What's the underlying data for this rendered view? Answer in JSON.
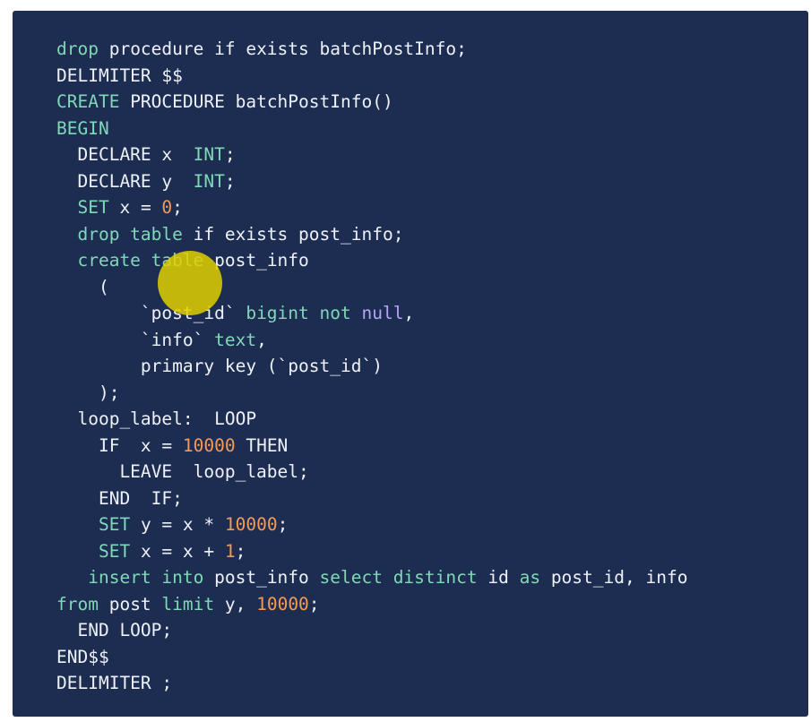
{
  "colors": {
    "background": "#1d2d52",
    "text": "#eef1f7",
    "keyword": "#7fd8b6",
    "number": "#f59a55",
    "literal": "#b8a4f5",
    "cursor": "#e2d000"
  },
  "code": {
    "lines": [
      [
        {
          "t": "drop",
          "c": "kw"
        },
        {
          "t": " procedure if exists batchPostInfo;",
          "c": "plain"
        }
      ],
      [
        {
          "t": "DELIMITER $$",
          "c": "plain"
        }
      ],
      [
        {
          "t": "CREATE",
          "c": "kw"
        },
        {
          "t": " PROCEDURE batchPostInfo()",
          "c": "plain"
        }
      ],
      [
        {
          "t": "BEGIN",
          "c": "kw"
        }
      ],
      [
        {
          "t": "  DECLARE x  ",
          "c": "plain"
        },
        {
          "t": "INT",
          "c": "kw"
        },
        {
          "t": ";",
          "c": "plain"
        }
      ],
      [
        {
          "t": "  DECLARE y  ",
          "c": "plain"
        },
        {
          "t": "INT",
          "c": "kw"
        },
        {
          "t": ";",
          "c": "plain"
        }
      ],
      [
        {
          "t": "  ",
          "c": "plain"
        },
        {
          "t": "SET",
          "c": "kw"
        },
        {
          "t": " x = ",
          "c": "plain"
        },
        {
          "t": "0",
          "c": "num"
        },
        {
          "t": ";",
          "c": "plain"
        }
      ],
      [
        {
          "t": "  ",
          "c": "plain"
        },
        {
          "t": "drop table",
          "c": "kw"
        },
        {
          "t": " if exists post_info;",
          "c": "plain"
        }
      ],
      [
        {
          "t": "  ",
          "c": "plain"
        },
        {
          "t": "create table",
          "c": "kw"
        },
        {
          "t": " post_info",
          "c": "plain"
        }
      ],
      [
        {
          "t": "    (",
          "c": "plain"
        }
      ],
      [
        {
          "t": "        `post_id` ",
          "c": "plain"
        },
        {
          "t": "bigint",
          "c": "kw"
        },
        {
          "t": " ",
          "c": "plain"
        },
        {
          "t": "not",
          "c": "kw"
        },
        {
          "t": " ",
          "c": "plain"
        },
        {
          "t": "null",
          "c": "lit"
        },
        {
          "t": ",",
          "c": "plain"
        }
      ],
      [
        {
          "t": "        `info` ",
          "c": "plain"
        },
        {
          "t": "text",
          "c": "kw"
        },
        {
          "t": ",",
          "c": "plain"
        }
      ],
      [
        {
          "t": "        primary key (`post_id`)",
          "c": "plain"
        }
      ],
      [
        {
          "t": "    );",
          "c": "plain"
        }
      ],
      [
        {
          "t": "  loop_label:  LOOP",
          "c": "plain"
        }
      ],
      [
        {
          "t": "    IF  x = ",
          "c": "plain"
        },
        {
          "t": "10000",
          "c": "num"
        },
        {
          "t": " THEN",
          "c": "plain"
        }
      ],
      [
        {
          "t": "      LEAVE  loop_label;",
          "c": "plain"
        }
      ],
      [
        {
          "t": "    END  IF;",
          "c": "plain"
        }
      ],
      [
        {
          "t": "    ",
          "c": "plain"
        },
        {
          "t": "SET",
          "c": "kw"
        },
        {
          "t": " y = x * ",
          "c": "plain"
        },
        {
          "t": "10000",
          "c": "num"
        },
        {
          "t": ";",
          "c": "plain"
        }
      ],
      [
        {
          "t": "    ",
          "c": "plain"
        },
        {
          "t": "SET",
          "c": "kw"
        },
        {
          "t": " x = x + ",
          "c": "plain"
        },
        {
          "t": "1",
          "c": "num"
        },
        {
          "t": ";",
          "c": "plain"
        }
      ],
      [
        {
          "t": "   ",
          "c": "plain"
        },
        {
          "t": "insert into",
          "c": "kw"
        },
        {
          "t": " post_info ",
          "c": "plain"
        },
        {
          "t": "select distinct",
          "c": "kw"
        },
        {
          "t": " id ",
          "c": "plain"
        },
        {
          "t": "as",
          "c": "kw"
        },
        {
          "t": " post_id, info",
          "c": "plain"
        }
      ],
      [
        {
          "t": "from",
          "c": "kw"
        },
        {
          "t": " post ",
          "c": "plain"
        },
        {
          "t": "limit",
          "c": "kw"
        },
        {
          "t": " y, ",
          "c": "plain"
        },
        {
          "t": "10000",
          "c": "num"
        },
        {
          "t": ";",
          "c": "plain"
        }
      ],
      [
        {
          "t": "  END LOOP;",
          "c": "plain"
        }
      ],
      [
        {
          "t": "END$$",
          "c": "plain"
        }
      ],
      [
        {
          "t": "DELIMITER ;",
          "c": "plain"
        }
      ]
    ]
  }
}
